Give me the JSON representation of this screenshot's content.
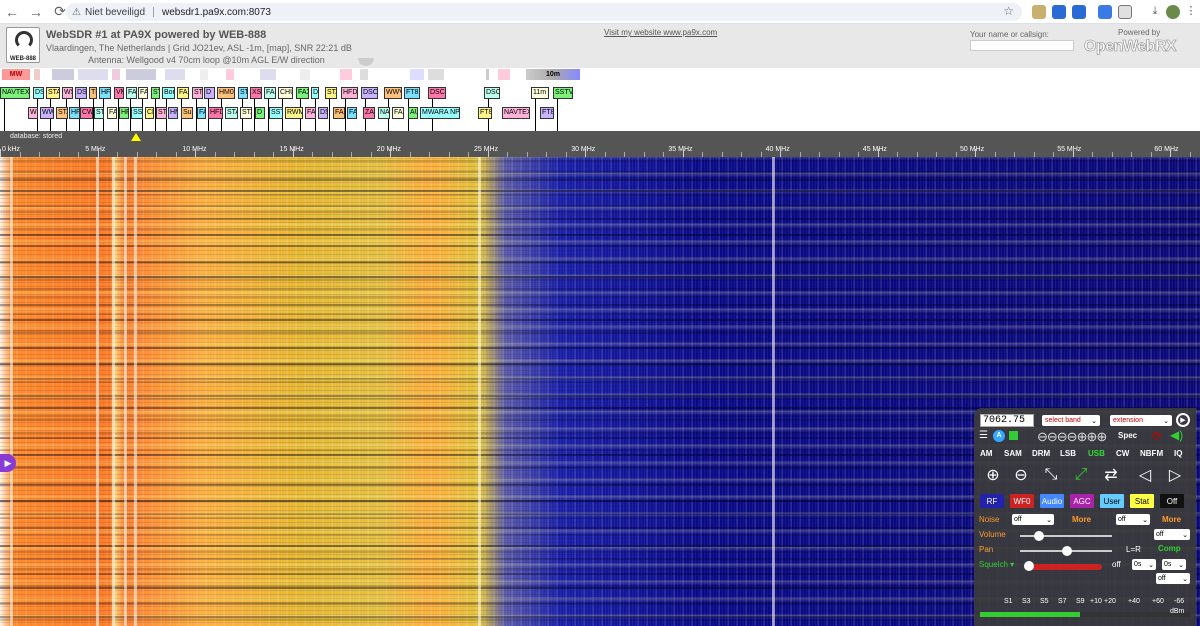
{
  "browser": {
    "security_label": "Niet beveiligd",
    "url": "websdr1.pa9x.com:8073"
  },
  "header": {
    "title": "WebSDR #1 at PA9X powered by WEB-888",
    "location_line": "Vlaardingen, The Netherlands | Grid JO21ev, ASL -1m, [map], SNR 22:21 dB",
    "antenna_line": "Antenna: Wellgood v4 70cm loop @10m AGL E/W direction",
    "website_link": "Visit my website www.pa9x.com",
    "callsign_label": "Your name or callsign:",
    "callsign_value": "",
    "powered_by": "Powered by",
    "openwebrx": "OpenWebRX",
    "logo_text": "WEB-888"
  },
  "bands": {
    "mw": "MW",
    "m10": "10m"
  },
  "row1_tags": [
    "NAVTEX",
    "DS",
    "STA",
    "WS",
    "DSC",
    "TH",
    "HFL",
    "VM",
    "FAX",
    "FAX",
    "STA",
    "Bon",
    "FAX",
    "STA",
    "D",
    "HM01",
    "STA",
    "XSC",
    "FAX",
    "CHU",
    "FAX",
    "D",
    "STA",
    "HFDL",
    "DSC",
    "WWV",
    "FT8",
    "DSC",
    "DSC",
    "11m",
    "SSTV"
  ],
  "row2_tags": [
    "WS",
    "WW",
    "STA",
    "HF",
    "CW",
    "STA",
    "FAX",
    "HF",
    "SST",
    "CH",
    "STA",
    "HM",
    "Su",
    "FAX",
    "HFDL",
    "STA",
    "STA",
    "D",
    "SST",
    "RWM",
    "FAX",
    "DS",
    "FAX",
    "FAX",
    "ZAR",
    "NAV",
    "FAX",
    "AUS",
    "MWARA NP",
    "FT8",
    "NAVTEX",
    "FT8"
  ],
  "scale": {
    "database": "database: stored",
    "labels": [
      "0 kHz",
      "5 MHz",
      "10 MHz",
      "15 MHz",
      "20 MHz",
      "25 MHz",
      "30 MHz",
      "35 MHz",
      "40 MHz",
      "45 MHz",
      "50 MHz",
      "55 MHz",
      "60 MHz"
    ]
  },
  "panel": {
    "frequency": "7062.75",
    "select_band": "select band",
    "extension": "extension",
    "spec": "Spec",
    "modes": [
      "AM",
      "SAM",
      "DRM",
      "LSB",
      "USB",
      "CW",
      "NBFM",
      "IQ"
    ],
    "active_mode": "USB",
    "tabs": [
      "RF",
      "WF0",
      "Audio",
      "AGC",
      "User",
      "Stat",
      "Off"
    ],
    "noise_label": "Noise",
    "volume_label": "Volume",
    "pan_label": "Pan",
    "squelch_label": "Squelch",
    "pan_lr": "L=R",
    "comp": "Comp",
    "more": "More",
    "off": "off",
    "zero_s": "0s",
    "squelch_off": "off",
    "smeter": [
      "S1",
      "S3",
      "S5",
      "S7",
      "S9",
      "+10",
      "+20",
      "+40",
      "+60",
      "-66"
    ],
    "dbm": "dBm"
  },
  "colors": {
    "accent_green": "#33dd33",
    "rf": "#2222aa",
    "wf0": "#cc2222",
    "audio": "#4488ff",
    "agc": "#aa22aa",
    "user": "#66ccff",
    "stat": "#ffff44",
    "off": "#111111"
  }
}
